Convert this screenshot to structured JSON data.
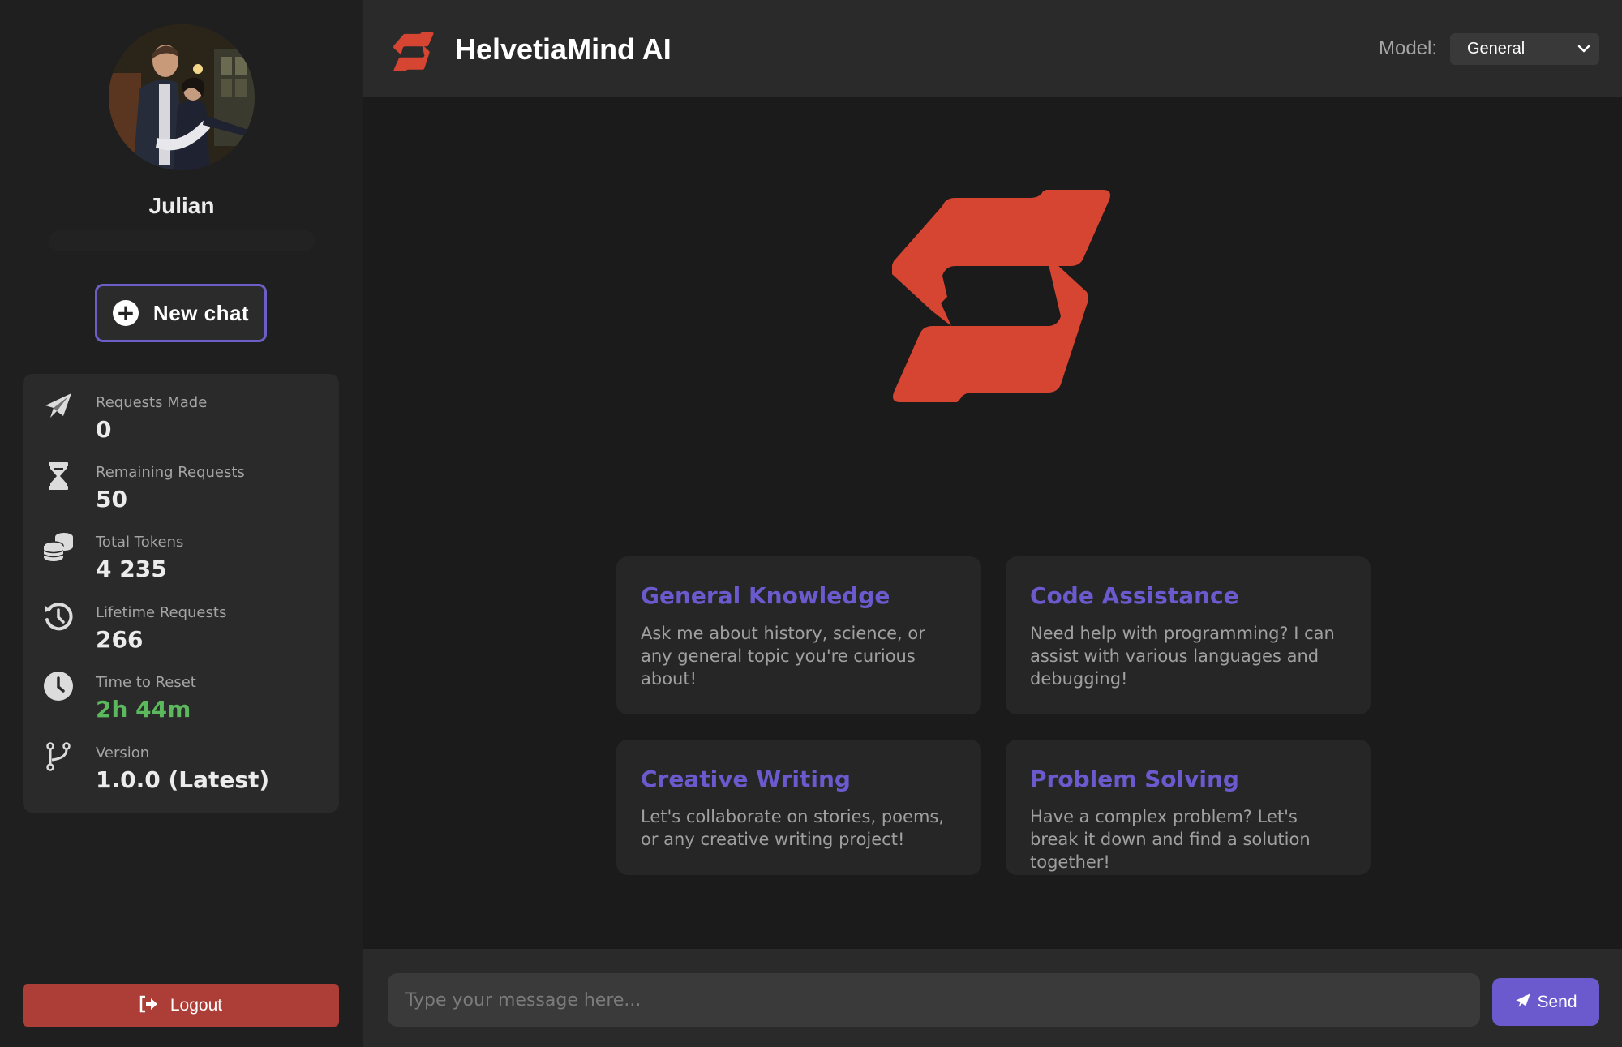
{
  "app": {
    "title": "HelvetiaMind AI",
    "brand_color": "#d64532",
    "accent_color": "#6a5acd"
  },
  "sidebar": {
    "user": {
      "name": "Julian",
      "avatar_icon": "user-photo"
    },
    "new_chat": {
      "label": "New chat",
      "icon": "plus-circle-icon"
    },
    "stats": [
      {
        "icon": "paper-plane-icon",
        "label": "Requests Made",
        "value": "0"
      },
      {
        "icon": "hourglass-icon",
        "label": "Remaining Requests",
        "value": "50"
      },
      {
        "icon": "coins-icon",
        "label": "Total Tokens",
        "value": "4 235"
      },
      {
        "icon": "history-icon",
        "label": "Lifetime Requests",
        "value": "266"
      },
      {
        "icon": "clock-icon",
        "label": "Time to Reset",
        "value": "2h 44m",
        "color": "#5cb85c"
      },
      {
        "icon": "branch-icon",
        "label": "Version",
        "value": "1.0.0 (Latest)"
      }
    ],
    "logout": {
      "label": "Logout",
      "icon": "sign-out-icon",
      "color": "#ad3d37"
    }
  },
  "header": {
    "title": "HelvetiaMind AI",
    "model_label": "Model:",
    "model_selected": "General"
  },
  "main": {
    "cards": [
      {
        "title": "General Knowledge",
        "description": "Ask me about history, science, or any general topic you're curious about!"
      },
      {
        "title": "Code Assistance",
        "description": "Need help with programming? I can assist with various languages and debugging!"
      },
      {
        "title": "Creative Writing",
        "description": "Let's collaborate on stories, poems, or any creative writing project!"
      },
      {
        "title": "Problem Solving",
        "description": "Have a complex problem? Let's break it down and find a solution together!"
      }
    ]
  },
  "composer": {
    "value": "",
    "placeholder": "Type your message here...",
    "send_label": "Send"
  }
}
